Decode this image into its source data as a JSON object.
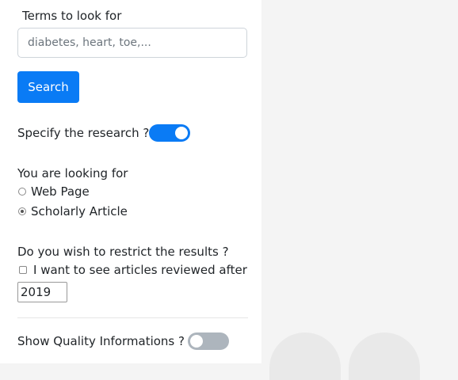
{
  "search": {
    "title": "Terms to look for",
    "placeholder": "diabetes, heart, toe,...",
    "button_label": "Search"
  },
  "specify": {
    "label": "Specify the research ?",
    "enabled": true
  },
  "looking_for": {
    "label": "You are looking for",
    "options": [
      {
        "label": "Web Page",
        "checked": false
      },
      {
        "label": "Scholarly Article",
        "checked": true
      }
    ]
  },
  "restrict": {
    "label": "Do you wish to restrict the results ?",
    "checkbox_label": "I want to see articles reviewed after",
    "checked": false,
    "year_value": "2019"
  },
  "quality": {
    "label": "Show Quality Informations ?",
    "enabled": false
  },
  "colors": {
    "accent": "#0a7bf5",
    "toggle_off": "#adb5bd",
    "background": "#f4f4f4"
  }
}
